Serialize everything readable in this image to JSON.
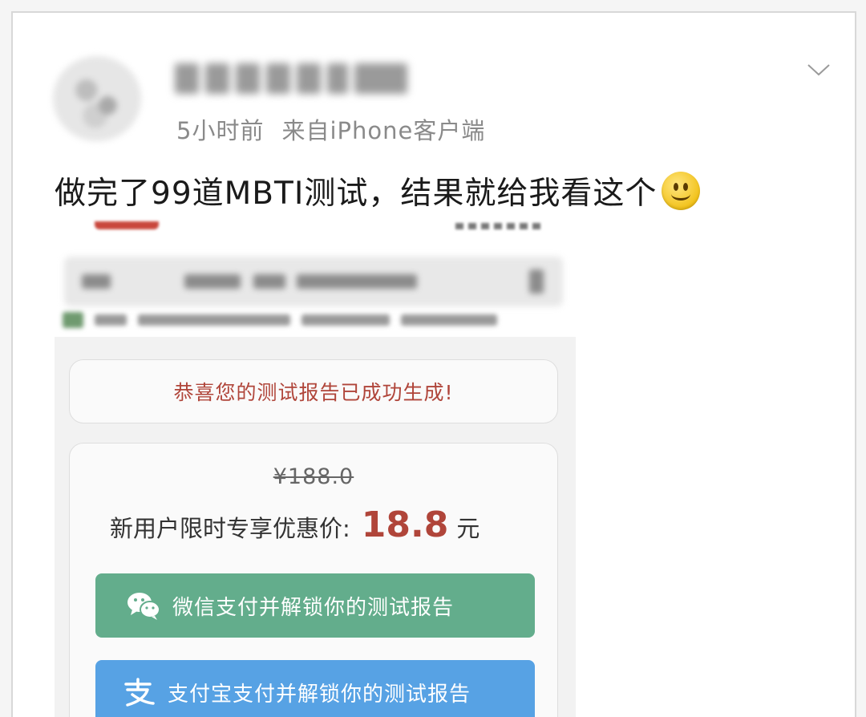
{
  "post": {
    "time": "5小时前",
    "source": "来自iPhone客户端",
    "text": "做完了99道MBTI测试，结果就给我看这个",
    "emoji": "smile-emoji"
  },
  "screenshot": {
    "congrats": "恭喜您的测试报告已成功生成!",
    "original_price": "¥188.0",
    "promo_label": "新用户限时专享优惠价:",
    "promo_amount": "18.8",
    "promo_unit": "元",
    "wechat_button": "微信支付并解锁你的测试报告",
    "alipay_button": "支付宝支付并解锁你的测试报告",
    "colors": {
      "accent_red": "#b0453a",
      "wechat_green": "#63ad8c",
      "alipay_blue": "#57a2e4"
    }
  },
  "icons": {
    "more": "chevron-down-icon",
    "wechat": "wechat-icon",
    "alipay": "alipay-icon"
  }
}
